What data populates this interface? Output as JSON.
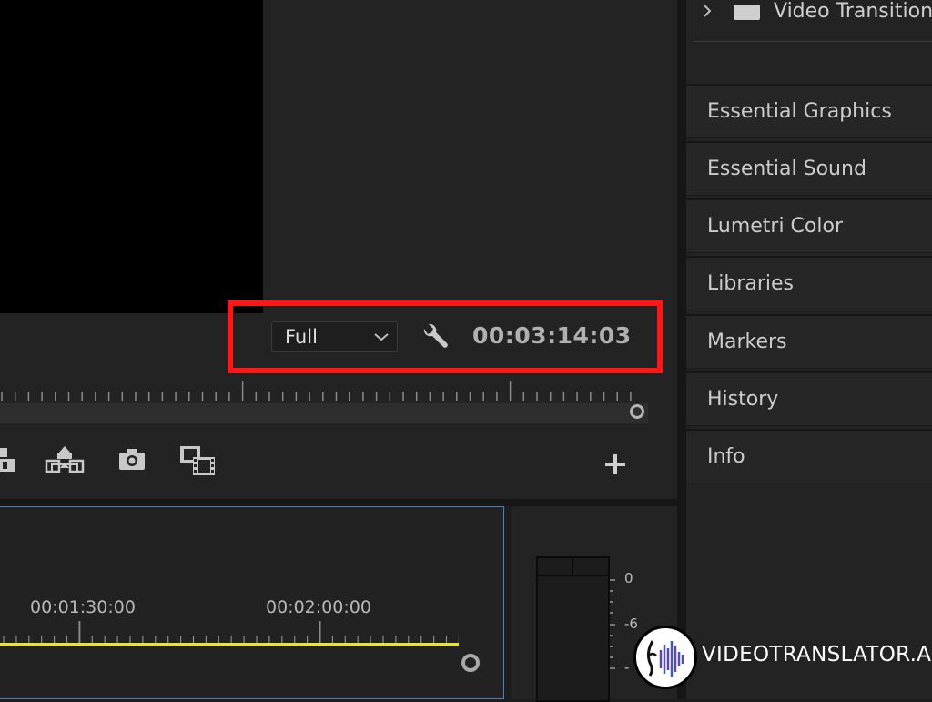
{
  "monitor": {
    "quality": {
      "selected": "Full"
    },
    "timecode": "00:03:14:03",
    "controls": {
      "overwrite_icon": "overwrite-icon",
      "extract_icon": "extract-icon",
      "export_frame_icon": "camera-icon",
      "compare_icon": "film-compare-icon",
      "add_button": "plus-icon"
    },
    "colors": {
      "highlight": "#ff1616"
    }
  },
  "right_panel": {
    "video_transitions": {
      "label": "Video Transitions"
    },
    "items": [
      {
        "label": "Essential Graphics"
      },
      {
        "label": "Essential Sound"
      },
      {
        "label": "Lumetri Color"
      },
      {
        "label": "Libraries"
      },
      {
        "label": "Markers"
      },
      {
        "label": "History"
      },
      {
        "label": "Info"
      }
    ]
  },
  "timeline": {
    "ruler_labels": [
      "00:01:30:00",
      "00:02:00:00"
    ],
    "colors": {
      "work_area": "#e8e24a",
      "selection_border": "#4f7fb8"
    }
  },
  "audio_meter": {
    "labels": [
      "0",
      "-6",
      "-"
    ]
  },
  "watermark": {
    "text": "VIDEOTRANSLATOR.AI"
  }
}
